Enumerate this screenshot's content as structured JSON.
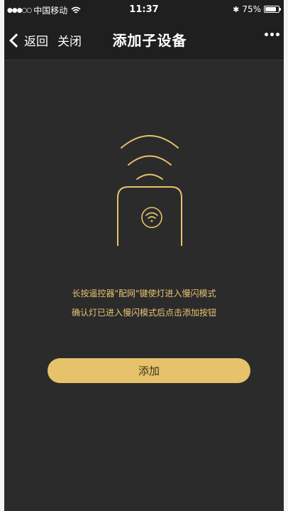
{
  "status_bar": {
    "carrier": "中国移动",
    "signal": "●●●○○",
    "time": "11:37",
    "bluetooth": "✱",
    "battery": "75%"
  },
  "nav": {
    "back_label": "返回",
    "close_label": "关闭",
    "title": "添加子设备"
  },
  "instructions": {
    "line1": "长按遥控器\"配网\"键使灯进入慢闪模式",
    "line2": "确认灯已进入慢闪模式后点击添加按钮"
  },
  "add_button": {
    "label": "添加"
  },
  "colors": {
    "accent": "#e6c36b",
    "background": "#2b2b2b",
    "bar": "#1f1f1f"
  },
  "icons": [
    "wifi-status-icon",
    "bluetooth-icon",
    "battery-icon",
    "back-chevron-icon",
    "more-icon",
    "signal-wave-icon",
    "remote-control-icon",
    "wifi-icon"
  ]
}
